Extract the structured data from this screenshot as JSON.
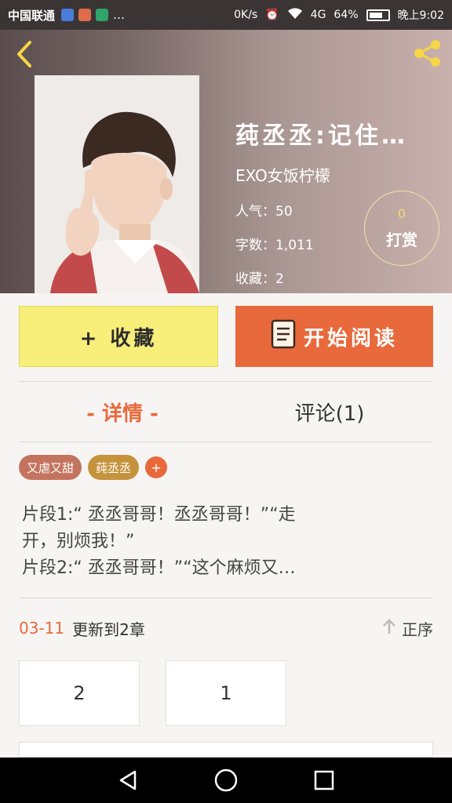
{
  "status_bar": {
    "carrier": "中国联通",
    "speed": "0K/s",
    "network": "4G",
    "battery": "64%",
    "time": "晚上9:02"
  },
  "book": {
    "title": "莼丞丞:记住…",
    "author": "EXO女饭柠檬",
    "popularity": "人气：50",
    "word_count": "字数：1,011",
    "favorites": "收藏：2"
  },
  "reward": {
    "count": "0",
    "label": "打赏"
  },
  "actions": {
    "collect": "+ 收藏",
    "read": "开始阅读"
  },
  "tabs": {
    "detail": "- 详情 -",
    "comments": "评论(1)"
  },
  "tags": [
    {
      "label": "又虐又甜",
      "color": "#c4745e"
    },
    {
      "label": "莼丞丞",
      "color": "#c6933d"
    },
    {
      "label": "+"
    }
  ],
  "summary": [
    "片段1:“ 丞丞哥哥！丞丞哥哥！”“走",
    "开，别烦我！”",
    "片段2:“ 丞丞哥哥！”“这个麻烦又…"
  ],
  "updates": {
    "date": "03-11",
    "text": "更新到2章",
    "sort": "正序",
    "chapters": [
      "2",
      "1"
    ]
  },
  "colors": {
    "accent": "#e8693c",
    "collect_bg": "#f8ef7a"
  }
}
